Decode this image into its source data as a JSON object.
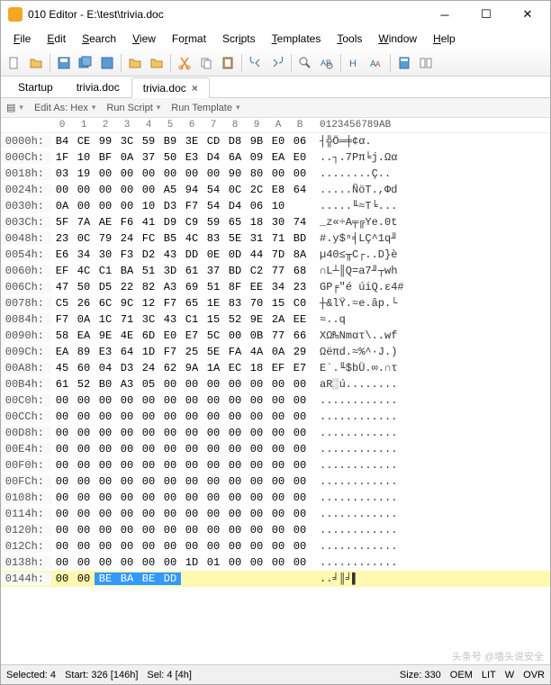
{
  "window": {
    "title": "010 Editor - E:\\test\\trivia.doc"
  },
  "menu": [
    "File",
    "Edit",
    "Search",
    "View",
    "Format",
    "Scripts",
    "Templates",
    "Tools",
    "Window",
    "Help"
  ],
  "menu_underline": [
    0,
    0,
    0,
    0,
    2,
    3,
    0,
    0,
    0,
    0
  ],
  "tabs": [
    {
      "label": "Startup",
      "active": false,
      "closable": false
    },
    {
      "label": "trivia.doc",
      "active": false,
      "closable": false
    },
    {
      "label": "trivia.doc",
      "active": true,
      "closable": true
    }
  ],
  "subtoolbar": {
    "editas": "Edit As: Hex",
    "runscript": "Run Script",
    "runtemplate": "Run Template"
  },
  "hex": {
    "col_headers": [
      "0",
      "1",
      "2",
      "3",
      "4",
      "5",
      "6",
      "7",
      "8",
      "9",
      "A",
      "B"
    ],
    "ascii_header": "0123456789AB",
    "rows": [
      {
        "addr": "0000h:",
        "b": [
          "B4",
          "CE",
          "99",
          "3C",
          "59",
          "B9",
          "3E",
          "CD",
          "D8",
          "9B",
          "E0",
          "06"
        ],
        "a": "┤╬Ö<Y╣>═╪¢α."
      },
      {
        "addr": "000Ch:",
        "b": [
          "1F",
          "10",
          "BF",
          "0A",
          "37",
          "50",
          "E3",
          "D4",
          "6A",
          "09",
          "EA",
          "E0"
        ],
        "a": "..┐.7Pπ╘j.Ωα"
      },
      {
        "addr": "0018h:",
        "b": [
          "03",
          "19",
          "00",
          "00",
          "00",
          "00",
          "00",
          "00",
          "90",
          "80",
          "00",
          "00"
        ],
        "a": "........Ç.."
      },
      {
        "addr": "0024h:",
        "b": [
          "00",
          "00",
          "00",
          "00",
          "00",
          "A5",
          "94",
          "54",
          "0C",
          "2C",
          "E8",
          "64"
        ],
        "a": ".....ÑöT.,Φd"
      },
      {
        "addr": "0030h:",
        "b": [
          "0A",
          "00",
          "00",
          "00",
          "10",
          "D3",
          "F7",
          "54",
          "D4",
          "06",
          "10",
          ""
        ],
        "a": ".....╙≈T╘..."
      },
      {
        "addr": "003Ch:",
        "b": [
          "5F",
          "7A",
          "AE",
          "F6",
          "41",
          "D9",
          "C9",
          "59",
          "65",
          "18",
          "30",
          "74"
        ],
        "a": "_z«÷A╤╔Ye.0t"
      },
      {
        "addr": "0048h:",
        "b": [
          "23",
          "0C",
          "79",
          "24",
          "FC",
          "B5",
          "4C",
          "83",
          "5E",
          "31",
          "71",
          "BD"
        ],
        "a": "#.y$ⁿ╡LÇ^1q╜"
      },
      {
        "addr": "0054h:",
        "b": [
          "E6",
          "34",
          "30",
          "F3",
          "D2",
          "43",
          "DD",
          "0E",
          "0D",
          "44",
          "7D",
          "8A"
        ],
        "a": "µ40≤╥C┌..D}è"
      },
      {
        "addr": "0060h:",
        "b": [
          "EF",
          "4C",
          "C1",
          "BA",
          "51",
          "3D",
          "61",
          "37",
          "BD",
          "C2",
          "77",
          "68"
        ],
        "a": "∩L┴║Q=a7╜┬wh"
      },
      {
        "addr": "006Ch:",
        "b": [
          "47",
          "50",
          "D5",
          "22",
          "82",
          "A3",
          "69",
          "51",
          "8F",
          "EE",
          "34",
          "23"
        ],
        "a": "GP╒\"é úiQ.ε4#"
      },
      {
        "addr": "0078h:",
        "b": [
          "C5",
          "26",
          "6C",
          "9C",
          "12",
          "F7",
          "65",
          "1E",
          "83",
          "70",
          "15",
          "C0"
        ],
        "a": "┼&lŸ.≈e.âp.└"
      },
      {
        "addr": "0084h:",
        "b": [
          "F7",
          "0A",
          "1C",
          "71",
          "3C",
          "43",
          "C1",
          "15",
          "52",
          "9E",
          "2A",
          "EE"
        ],
        "a": "≈..q<C┴.R₧*ε"
      },
      {
        "addr": "0090h:",
        "b": [
          "58",
          "EA",
          "9E",
          "4E",
          "6D",
          "E0",
          "E7",
          "5C",
          "00",
          "0B",
          "77",
          "66"
        ],
        "a": "XΩ₧Nmατ\\..wf"
      },
      {
        "addr": "009Ch:",
        "b": [
          "EA",
          "89",
          "E3",
          "64",
          "1D",
          "F7",
          "25",
          "5E",
          "FA",
          "4A",
          "0A",
          "29"
        ],
        "a": "Ωëπd.≈%^·J.)"
      },
      {
        "addr": "00A8h:",
        "b": [
          "45",
          "60",
          "04",
          "D3",
          "24",
          "62",
          "9A",
          "1A",
          "EC",
          "18",
          "EF",
          "E7"
        ],
        "a": "E`.╙$bÜ.∞.∩τ"
      },
      {
        "addr": "00B4h:",
        "b": [
          "61",
          "52",
          "B0",
          "A3",
          "05",
          "00",
          "00",
          "00",
          "00",
          "00",
          "00",
          "00"
        ],
        "a": "aR░ú........"
      },
      {
        "addr": "00C0h:",
        "b": [
          "00",
          "00",
          "00",
          "00",
          "00",
          "00",
          "00",
          "00",
          "00",
          "00",
          "00",
          "00"
        ],
        "a": "............"
      },
      {
        "addr": "00CCh:",
        "b": [
          "00",
          "00",
          "00",
          "00",
          "00",
          "00",
          "00",
          "00",
          "00",
          "00",
          "00",
          "00"
        ],
        "a": "............"
      },
      {
        "addr": "00D8h:",
        "b": [
          "00",
          "00",
          "00",
          "00",
          "00",
          "00",
          "00",
          "00",
          "00",
          "00",
          "00",
          "00"
        ],
        "a": "............"
      },
      {
        "addr": "00E4h:",
        "b": [
          "00",
          "00",
          "00",
          "00",
          "00",
          "00",
          "00",
          "00",
          "00",
          "00",
          "00",
          "00"
        ],
        "a": "............"
      },
      {
        "addr": "00F0h:",
        "b": [
          "00",
          "00",
          "00",
          "00",
          "00",
          "00",
          "00",
          "00",
          "00",
          "00",
          "00",
          "00"
        ],
        "a": "............"
      },
      {
        "addr": "00FCh:",
        "b": [
          "00",
          "00",
          "00",
          "00",
          "00",
          "00",
          "00",
          "00",
          "00",
          "00",
          "00",
          "00"
        ],
        "a": "............"
      },
      {
        "addr": "0108h:",
        "b": [
          "00",
          "00",
          "00",
          "00",
          "00",
          "00",
          "00",
          "00",
          "00",
          "00",
          "00",
          "00"
        ],
        "a": "............"
      },
      {
        "addr": "0114h:",
        "b": [
          "00",
          "00",
          "00",
          "00",
          "00",
          "00",
          "00",
          "00",
          "00",
          "00",
          "00",
          "00"
        ],
        "a": "............"
      },
      {
        "addr": "0120h:",
        "b": [
          "00",
          "00",
          "00",
          "00",
          "00",
          "00",
          "00",
          "00",
          "00",
          "00",
          "00",
          "00"
        ],
        "a": "............"
      },
      {
        "addr": "012Ch:",
        "b": [
          "00",
          "00",
          "00",
          "00",
          "00",
          "00",
          "00",
          "00",
          "00",
          "00",
          "00",
          "00"
        ],
        "a": "............"
      },
      {
        "addr": "0138h:",
        "b": [
          "00",
          "00",
          "00",
          "00",
          "00",
          "00",
          "1D",
          "01",
          "00",
          "00",
          "00",
          "00"
        ],
        "a": "............"
      },
      {
        "addr": "0144h:",
        "b": [
          "00",
          "00",
          "BE",
          "BA",
          "BE",
          "DD",
          "",
          "",
          "",
          "",
          "",
          ""
        ],
        "a": "..╛║╛▌",
        "hl": true,
        "selStart": 2,
        "selEnd": 5
      }
    ]
  },
  "status": {
    "selected": "Selected: 4",
    "start": "Start: 326 [146h]",
    "sel": "Sel: 4 [4h]",
    "size": "Size: 330",
    "oem": "OEM",
    "lit": "LIT",
    "w": "W",
    "ovr": "OVR"
  },
  "watermark": "头条号 @墙头说安全"
}
